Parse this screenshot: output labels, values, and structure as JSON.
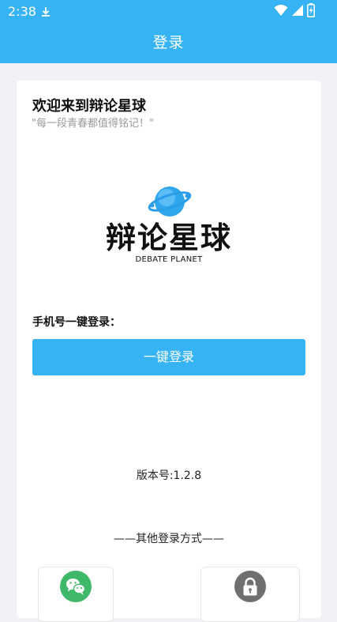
{
  "status_bar": {
    "time": "2:38",
    "download_icon": "download-icon",
    "wifi_icon": "wifi-icon",
    "signal_icon": "cell-signal-icon",
    "battery_icon": "battery-charging-icon"
  },
  "app_bar": {
    "title": "登录"
  },
  "card": {
    "welcome": "欢迎来到辩论星球",
    "slogan": "\"每一段青春都值得铭记！\"",
    "logo": {
      "wordmark": "辩论星球",
      "subtext": "DEBATE PLANET",
      "icon": "planet-icon"
    },
    "phone_login_label": "手机号一键登录：",
    "onekey_button": "一键登录",
    "version_text": "版本号:1.2.8",
    "other_login_label": "——其他登录方式——",
    "methods": [
      {
        "icon": "wechat-icon"
      },
      {
        "icon": "lock-icon"
      }
    ]
  },
  "colors": {
    "accent": "#35b3f5",
    "background": "#f1f2f6",
    "wechat": "#3fb86a",
    "lock": "#6f6f6f"
  }
}
